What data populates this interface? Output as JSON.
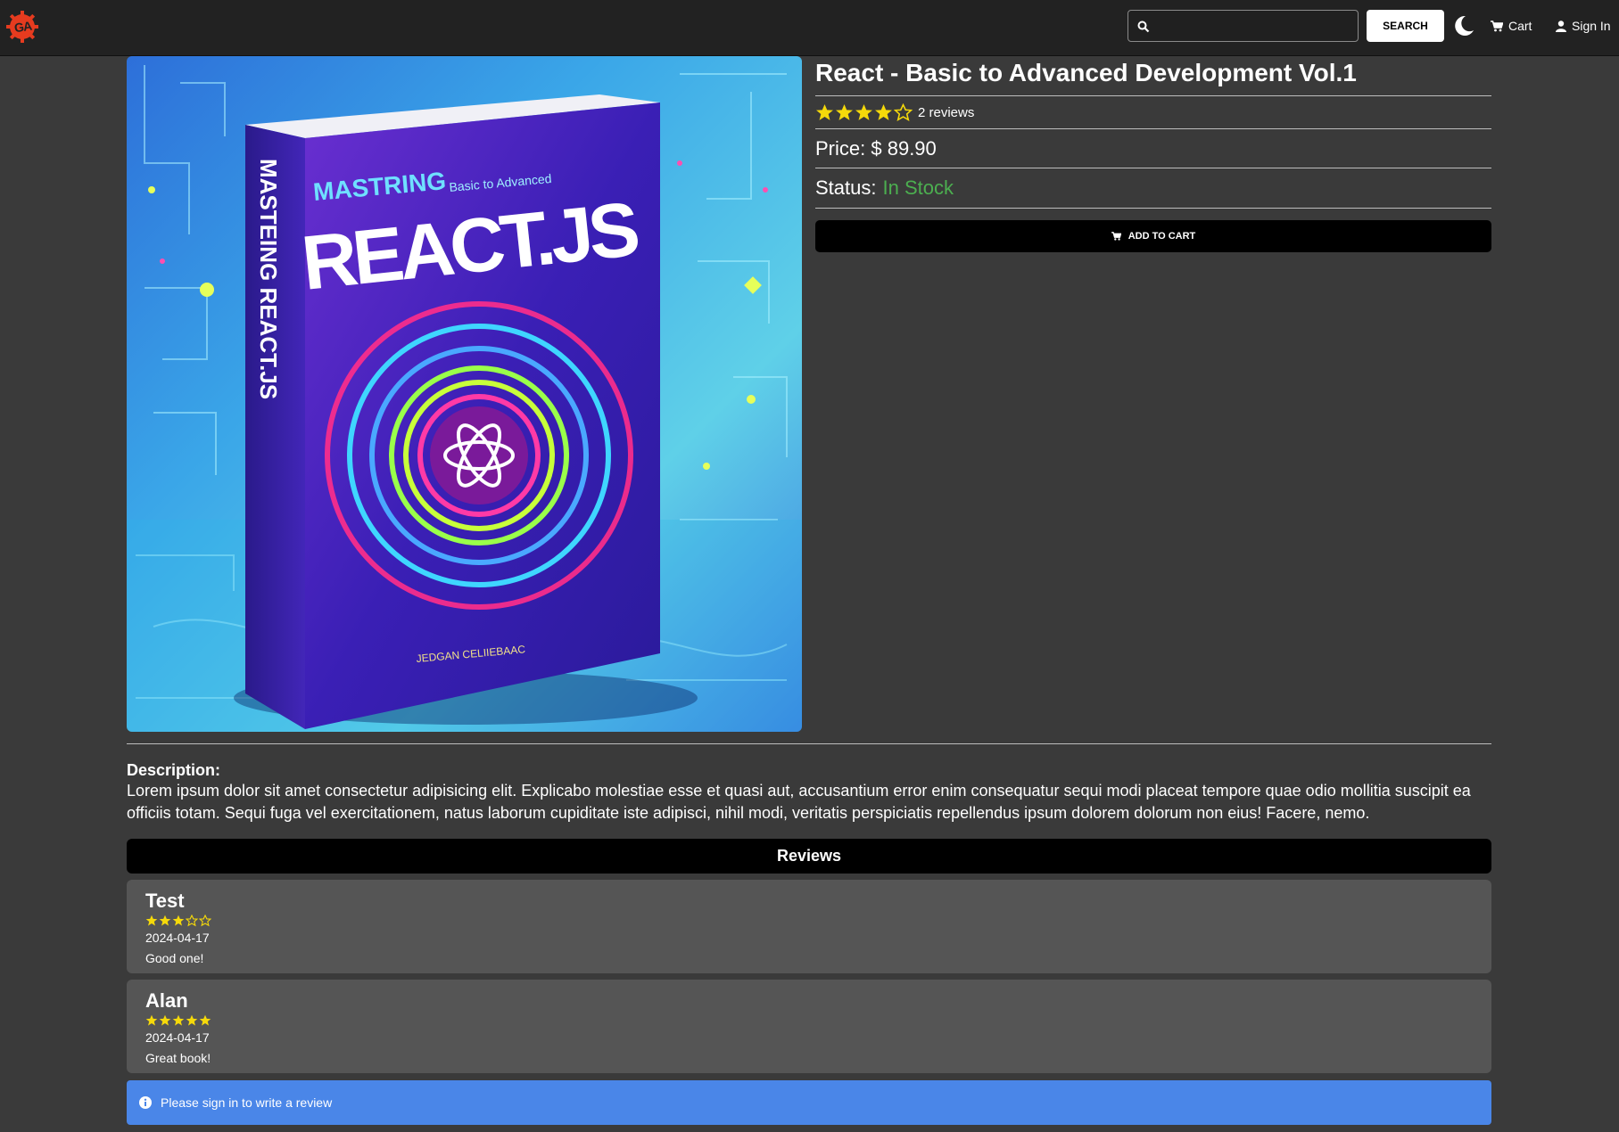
{
  "navbar": {
    "logo_text": "GA",
    "search": {
      "value": "",
      "placeholder": ""
    },
    "search_button": "SEARCH",
    "theme_toggle_icon": "moon-icon",
    "cart_label": "Cart",
    "signin_label": "Sign In"
  },
  "product": {
    "title": "React - Basic to Advanced Development Vol.1",
    "rating": 4,
    "rating_max": 5,
    "reviews_count": "2 reviews",
    "price_label": "Price:",
    "price_value": "$ 89.90",
    "status_label": "Status:",
    "status_value": "In Stock",
    "add_to_cart": "ADD TO CART",
    "image": {
      "cover_top_text": "MASTRING",
      "cover_sub_text": "Basic to Advanced",
      "cover_title": "REACT.JS",
      "spine_text": "MASTEING REACT.JS",
      "cover_author": "JEDGAN CELIIEBAAC"
    }
  },
  "description": {
    "label": "Description:",
    "text": "Lorem ipsum dolor sit amet consectetur adipisicing elit. Explicabo molestiae esse et quasi aut, accusantium error enim consequatur sequi modi placeat tempore quae odio mollitia suscipit ea officiis totam. Sequi fuga vel exercitationem, natus laborum cupiditate iste adipisci, nihil modi, veritatis perspiciatis repellendus ipsum dolorem dolorum non eius! Facere, nemo."
  },
  "reviews": {
    "header": "Reviews",
    "items": [
      {
        "name": "Test",
        "rating": 3,
        "date": "2024-04-17",
        "comment": "Good one!"
      },
      {
        "name": "Alan",
        "rating": 5,
        "date": "2024-04-17",
        "comment": "Great book!"
      }
    ]
  },
  "alert": {
    "icon": "info-icon",
    "text": "Please sign in to write a review"
  },
  "colors": {
    "background": "#3a3a3a",
    "navbar": "#222222",
    "star": "#f5d90a",
    "in_stock": "#4caf50",
    "alert": "#4a86e8",
    "review_card": "#555555"
  }
}
